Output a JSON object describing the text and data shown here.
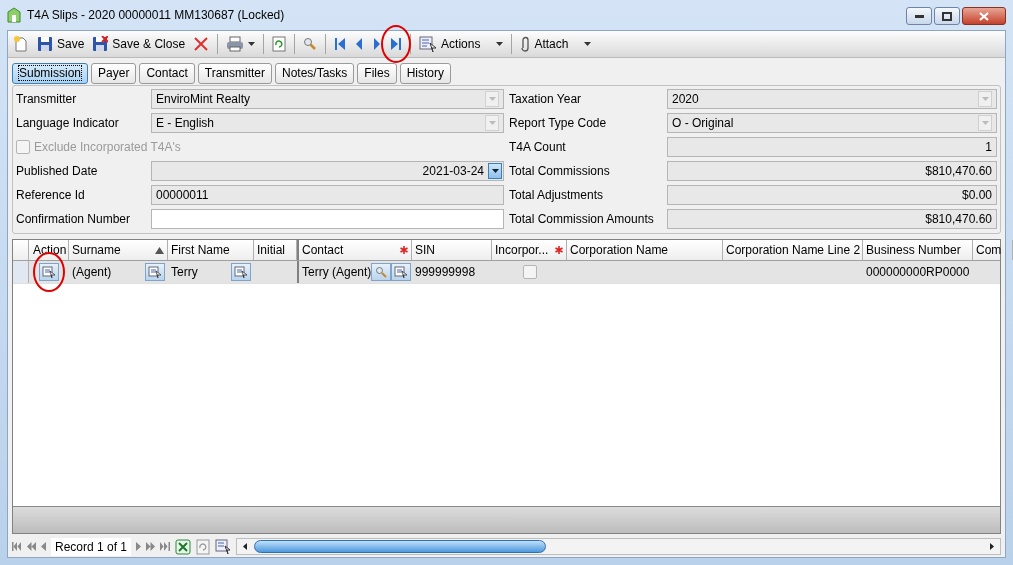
{
  "window": {
    "title": "T4A Slips - 2020 00000011 MM130687 (Locked)"
  },
  "toolbar": {
    "save": "Save",
    "save_close": "Save & Close",
    "actions": "Actions",
    "attach": "Attach"
  },
  "tabs": [
    {
      "label": "Submission",
      "selected": true
    },
    {
      "label": "Payer",
      "selected": false
    },
    {
      "label": "Contact",
      "selected": false
    },
    {
      "label": "Transmitter",
      "selected": false
    },
    {
      "label": "Notes/Tasks",
      "selected": false
    },
    {
      "label": "Files",
      "selected": false
    },
    {
      "label": "History",
      "selected": false
    }
  ],
  "form_left": [
    {
      "kind": "combo",
      "label": "Transmitter",
      "value": "EnviroMint Realty"
    },
    {
      "kind": "combo",
      "label": "Language Indicator",
      "value": "E - English"
    },
    {
      "kind": "checkbox",
      "label": "Exclude Incorporated T4A's",
      "checked": false,
      "disabled": true
    },
    {
      "kind": "date",
      "label": "Published Date",
      "value": "2021-03-24"
    },
    {
      "kind": "text",
      "label": "Reference Id",
      "value": "00000011",
      "readonly": true
    },
    {
      "kind": "text",
      "label": "Confirmation Number",
      "readonly": false
    }
  ],
  "form_right": [
    {
      "kind": "combo",
      "label": "Taxation Year",
      "value": "2020"
    },
    {
      "kind": "combo",
      "label": "Report Type Code",
      "value": "O - Original"
    },
    {
      "kind": "number",
      "label": "T4A Count",
      "value": "1"
    },
    {
      "kind": "number",
      "label": "Total Commissions",
      "value": "$810,470.60"
    },
    {
      "kind": "number",
      "label": "Total Adjustments",
      "value": "$0.00"
    },
    {
      "kind": "number",
      "label": "Total Commission Amounts",
      "value": "$810,470.60"
    }
  ],
  "grid": {
    "columns": [
      {
        "label": "Action",
        "required": false,
        "sorted": false
      },
      {
        "label": "Surname",
        "required": false,
        "sorted": true
      },
      {
        "label": "First Name",
        "required": false,
        "sorted": false
      },
      {
        "label": "Initial",
        "required": false,
        "sorted": false
      },
      {
        "label": "Contact",
        "required": true,
        "sorted": false
      },
      {
        "label": "SIN",
        "required": false,
        "sorted": false
      },
      {
        "label": "Incorpor...",
        "required": true,
        "sorted": false
      },
      {
        "label": "Corporation Name",
        "required": false,
        "sorted": false
      },
      {
        "label": "Corporation Name Line 2",
        "required": false,
        "sorted": false
      },
      {
        "label": "Business Number",
        "required": false,
        "sorted": false
      },
      {
        "label": "Com",
        "required": false,
        "sorted": false
      }
    ],
    "rows": [
      {
        "selected": true,
        "surname": "(Agent)",
        "first_name": "Terry",
        "contact": "Terry (Agent)",
        "sin": "999999998",
        "incorporated": false,
        "business_number": "000000000RP0000"
      }
    ]
  },
  "navigator": {
    "record": "Record 1 of 1"
  }
}
